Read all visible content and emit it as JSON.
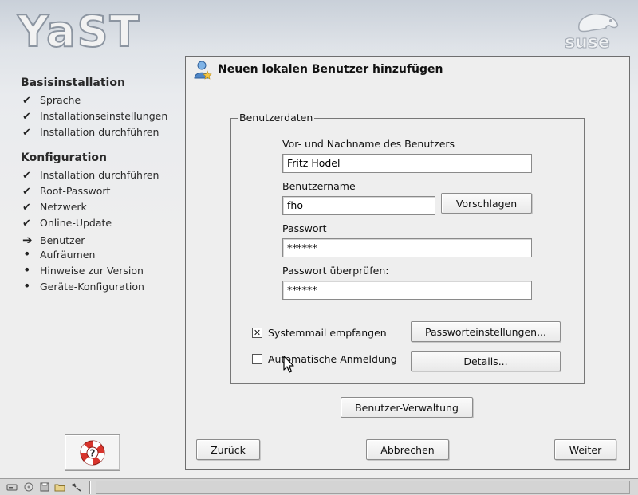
{
  "header": {
    "app_logo_text": "YaST",
    "brand_logo_text": "suse"
  },
  "sidebar": {
    "sections": [
      {
        "heading": "Basisinstallation",
        "items": [
          {
            "label": "Sprache",
            "state": "done"
          },
          {
            "label": "Installationseinstellungen",
            "state": "done"
          },
          {
            "label": "Installation durchführen",
            "state": "done"
          }
        ]
      },
      {
        "heading": "Konfiguration",
        "items": [
          {
            "label": "Installation durchführen",
            "state": "done"
          },
          {
            "label": "Root-Passwort",
            "state": "done"
          },
          {
            "label": "Netzwerk",
            "state": "done"
          },
          {
            "label": "Online-Update",
            "state": "done"
          },
          {
            "label": "Benutzer",
            "state": "current"
          },
          {
            "label": "Aufräumen",
            "state": "pending"
          },
          {
            "label": "Hinweise zur Version",
            "state": "pending"
          },
          {
            "label": "Geräte-Konfiguration",
            "state": "pending"
          }
        ]
      }
    ],
    "marks": {
      "done": "✔",
      "current": "➔",
      "pending": "•"
    },
    "help_icon": "help-lifebuoy-icon"
  },
  "dialog": {
    "title": "Neuen lokalen Benutzer hinzufügen",
    "title_icon": "user-add-icon",
    "group_label": "Benutzerdaten",
    "fullname": {
      "label": "Vor- und Nachname des Benutzers",
      "value": "Fritz Hodel"
    },
    "username": {
      "label": "Benutzername",
      "value": "fho"
    },
    "suggest_button": "Vorschlagen",
    "password": {
      "label": "Passwort",
      "value": "******"
    },
    "password_confirm": {
      "label": "Passwort überprüfen:",
      "value": "******"
    },
    "systemmail": {
      "label": "Systemmail empfangen",
      "checked": true
    },
    "autologin": {
      "label": "Automatische Anmeldung",
      "checked": false
    },
    "password_settings_button": "Passworteinstellungen...",
    "details_button": "Details...",
    "user_admin_button": "Benutzer-Verwaltung",
    "back_button": "Zurück",
    "cancel_button": "Abbrechen",
    "next_button": "Weiter"
  },
  "taskbar": {
    "icons": [
      "drive-icon",
      "disc-icon",
      "floppy-icon",
      "folder-icon",
      "tools-icon"
    ]
  }
}
